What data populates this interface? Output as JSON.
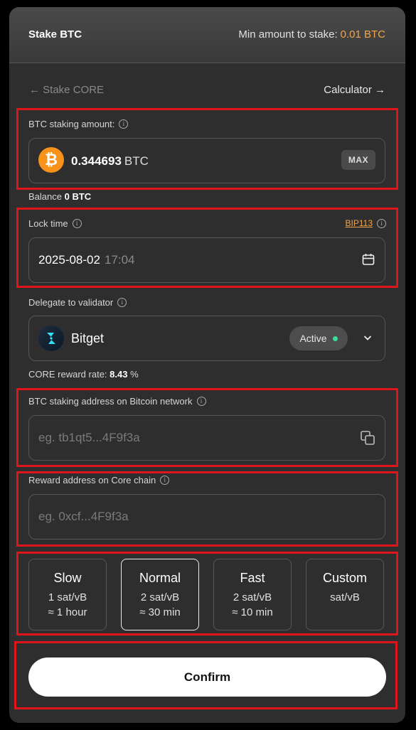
{
  "header": {
    "title": "Stake BTC",
    "min_label": "Min amount to stake:",
    "min_value": "0.01 BTC"
  },
  "nav": {
    "back": "← Stake CORE",
    "calculator": "Calculator →"
  },
  "btc_amount": {
    "label": "BTC staking amount:",
    "value": "0.344693",
    "unit": "BTC",
    "max_label": "MAX",
    "balance_label": "Balance",
    "balance_value": "0 BTC"
  },
  "lock_time": {
    "label": "Lock time",
    "bip_label": "BIP113",
    "date": "2025-08-02",
    "time": "17:04"
  },
  "validator": {
    "label": "Delegate to validator",
    "name": "Bitget",
    "status": "Active",
    "reward_label": "CORE reward rate:",
    "reward_value": "8.43",
    "reward_unit": "%"
  },
  "btc_address": {
    "label": "BTC staking address on Bitcoin network",
    "placeholder": "eg. tb1qt5...4F9f3a"
  },
  "reward_address": {
    "label": "Reward address on Core chain",
    "placeholder": "eg. 0xcf...4F9f3a"
  },
  "fees": [
    {
      "name": "Slow",
      "rate": "1 sat/vB",
      "time": "≈ 1 hour"
    },
    {
      "name": "Normal",
      "rate": "2 sat/vB",
      "time": "≈ 30 min"
    },
    {
      "name": "Fast",
      "rate": "2 sat/vB",
      "time": "≈ 10 min"
    },
    {
      "name": "Custom",
      "rate": "sat/vB",
      "time": ""
    }
  ],
  "selected_fee": "Normal",
  "confirm_label": "Confirm",
  "colors": {
    "accent": "#f3a44a",
    "btc": "#f7931a",
    "active": "#3ddc97",
    "highlight": "#e0141b"
  },
  "icons": [
    "info-icon",
    "bitcoin-icon",
    "calendar-icon",
    "bitget-logo-icon",
    "chevron-down-icon",
    "copy-icon"
  ]
}
